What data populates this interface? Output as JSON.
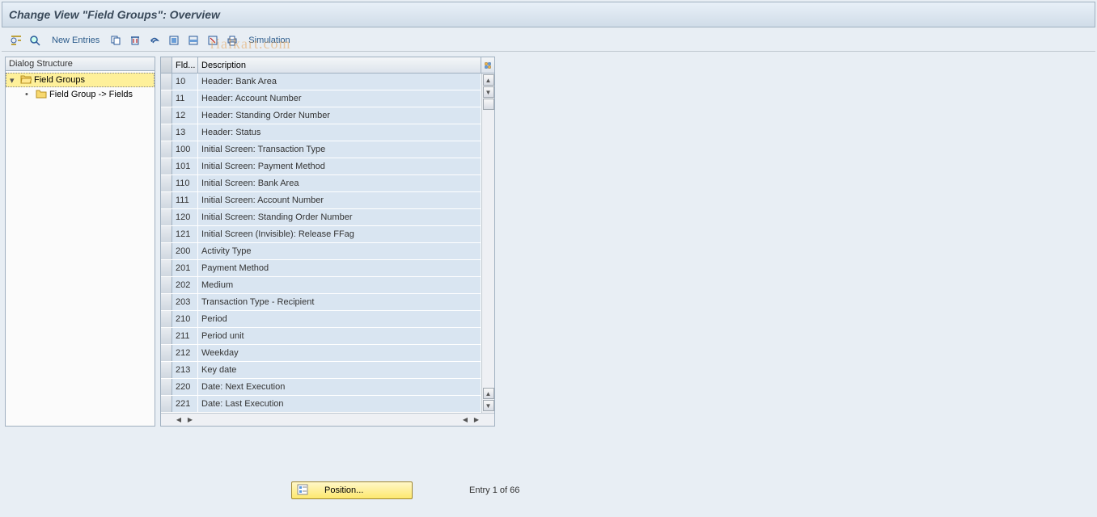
{
  "title": "Change View \"Field Groups\": Overview",
  "toolbar": {
    "new_entries": "New Entries",
    "simulation": "Simulation"
  },
  "tree": {
    "header": "Dialog Structure",
    "items": [
      {
        "label": "Field Groups",
        "selected": true,
        "level": 0,
        "expanded": true
      },
      {
        "label": "Field Group -> Fields",
        "selected": false,
        "level": 1
      }
    ]
  },
  "table": {
    "columns": {
      "fld": "Fld...",
      "desc": "Description"
    },
    "rows": [
      {
        "fld": "10",
        "desc": "Header: Bank Area"
      },
      {
        "fld": "11",
        "desc": "Header: Account Number"
      },
      {
        "fld": "12",
        "desc": "Header: Standing Order Number"
      },
      {
        "fld": "13",
        "desc": "Header: Status"
      },
      {
        "fld": "100",
        "desc": "Initial Screen: Transaction Type"
      },
      {
        "fld": "101",
        "desc": "Initial Screen: Payment Method"
      },
      {
        "fld": "110",
        "desc": "Initial Screen: Bank Area"
      },
      {
        "fld": "111",
        "desc": "Initial Screen: Account Number"
      },
      {
        "fld": "120",
        "desc": "Initial Screen: Standing Order Number"
      },
      {
        "fld": "121",
        "desc": "Initial Screen (Invisible): Release FFag"
      },
      {
        "fld": "200",
        "desc": "Activity Type"
      },
      {
        "fld": "201",
        "desc": "Payment Method"
      },
      {
        "fld": "202",
        "desc": "Medium"
      },
      {
        "fld": "203",
        "desc": "Transaction Type - Recipient"
      },
      {
        "fld": "210",
        "desc": "Period"
      },
      {
        "fld": "211",
        "desc": "Period unit"
      },
      {
        "fld": "212",
        "desc": "Weekday"
      },
      {
        "fld": "213",
        "desc": "Key date"
      },
      {
        "fld": "220",
        "desc": "Date: Next Execution"
      },
      {
        "fld": "221",
        "desc": "Date: Last Execution"
      }
    ]
  },
  "footer": {
    "position_label": "Position...",
    "entry_text": "Entry 1 of 66"
  },
  "watermark": "rialkart.com"
}
